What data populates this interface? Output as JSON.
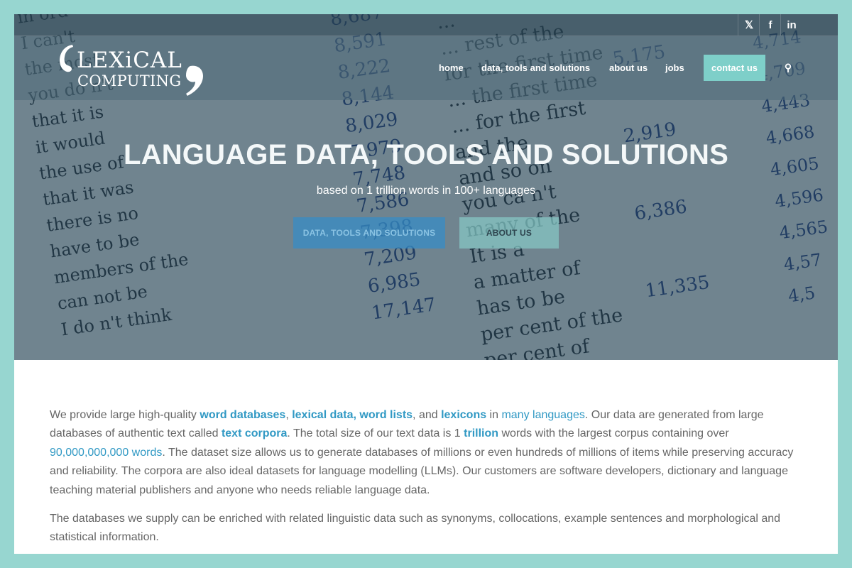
{
  "social": {
    "x_icon": "x-twitter-icon",
    "facebook_icon": "facebook-icon",
    "linkedin_icon": "linkedin-icon",
    "x_glyph": "𝕏",
    "facebook_glyph": "f",
    "linkedin_glyph": "in"
  },
  "logo": {
    "line1": "LEXiCAL",
    "line2": "COMPUTING"
  },
  "nav": {
    "home": "home",
    "data": "data, tools and solutions",
    "about": "about us",
    "jobs": "jobs",
    "contact": "contact us",
    "search_icon": "search-icon",
    "search_glyph": "⚲"
  },
  "hero": {
    "title": "LANGUAGE DATA, TOOLS AND SOLUTIONS",
    "subtitle": "based on 1 trillion words in 100+ languages",
    "btn_data": "DATA, TOOLS AND SOLUTIONS",
    "btn_about": "ABOUT US",
    "bg_col1": [
      "in ord",
      "I can't",
      "the most",
      "you do n't",
      "that it is",
      "it would",
      "the use of",
      "that it was",
      "there is no",
      "have to be",
      "members of the",
      "can not be",
      "I do n't think"
    ],
    "bg_col2": [
      "8,687",
      "8,591",
      "8,222",
      "8,144",
      "8,029",
      "7,979",
      "7,748",
      "7,586",
      "7,398",
      "7,209",
      "6,985",
      "17,147"
    ],
    "bg_col3": [
      "...",
      "... rest of the",
      "for the first time",
      "... the first time",
      "... for the first",
      "and the",
      "and so on",
      "you ca n't",
      "many of the",
      "It is a",
      "a matter of",
      "has to be",
      "per cent of the",
      "per cent of"
    ],
    "bg_col4": [
      "5,175",
      "2,919",
      "6,386",
      "11,335"
    ],
    "bg_col5": [
      "4,714",
      "4,709",
      "4,443",
      "4,668",
      "4,605",
      "4,596",
      "4,565",
      "4,57",
      "4,5"
    ]
  },
  "body": {
    "p1": {
      "t1": "We provide large high-quality ",
      "l1": "word databases",
      "t2": ", ",
      "l2": "lexical data, word lists",
      "t3": ", and ",
      "l3": "lexicons",
      "t4": " in ",
      "l4": "many languages",
      "t5": ". Our data are generated from large databases of authentic text called ",
      "l5": "text corpora",
      "t6": ". The total size of our text data is 1 ",
      "l6": "trillion",
      "t7": " words with the largest corpus containing over ",
      "l7": "90,000,000,000 words",
      "t8": ". The dataset size allows us to generate databases of millions or even hundreds of millions of items while preserving accuracy and reliability. The corpora are also ideal datasets for language modelling (LLMs). Our customers are software developers, dictionary and language teaching material publishers and anyone who needs reliable language data."
    },
    "p2": "The databases we supply can be enriched with related linguistic data such as synonyms, collocations, example sentences and morphological and statistical information."
  },
  "colors": {
    "page_border": "#97d6d0",
    "accent": "#7ecfc9",
    "link": "#3199c4",
    "body_text": "#666666"
  }
}
